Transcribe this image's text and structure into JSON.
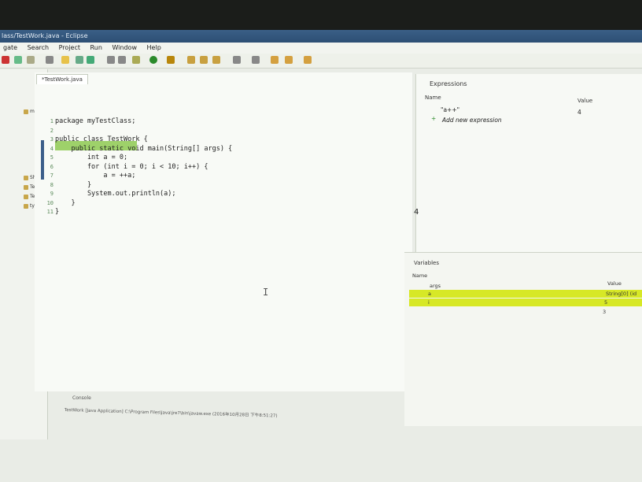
{
  "window": {
    "title": "lass/TestWork.java - Eclipse"
  },
  "menu": [
    "gate",
    "Search",
    "Project",
    "Run",
    "Window",
    "Help"
  ],
  "project_tree": {
    "items": [
      "myT",
      "Sho",
      "Tes",
      "Tes",
      "typ"
    ]
  },
  "editor": {
    "tab_label": "*TestWork.java",
    "lines": [
      {
        "no": "1",
        "text": "package myTestClass;"
      },
      {
        "no": "2",
        "text": ""
      },
      {
        "no": "3",
        "text": "public class TestWork {"
      },
      {
        "no": "4",
        "text": "    public static void main(String[] args) {"
      },
      {
        "no": "5",
        "text": "        int a = 0;"
      },
      {
        "no": "6",
        "text": "        for (int i = 0; i < 10; i++) {"
      },
      {
        "no": "7",
        "text": "            a = ++a;"
      },
      {
        "no": "8",
        "text": "        }"
      },
      {
        "no": "9",
        "text": "        System.out.println(a);"
      },
      {
        "no": "10",
        "text": "    }"
      },
      {
        "no": "11",
        "text": "}"
      }
    ]
  },
  "expressions": {
    "title": "Expressions",
    "col_name": "Name",
    "col_value": "Value",
    "row_name": "\"a++\"",
    "row_value": "4",
    "add_label": "Add new expression",
    "detail_value": "4"
  },
  "variables": {
    "title": "Variables",
    "col_name": "Name",
    "col_value": "Value",
    "rows": [
      {
        "name": "args",
        "value": "String[0] (id"
      },
      {
        "name": "a",
        "value": "5"
      },
      {
        "name": "i",
        "value": "3"
      }
    ]
  },
  "console": {
    "title": "Console",
    "status": "TestWork [Java Application] C:\\Program Files\\Java\\jre7\\bin\\javaw.exe (2016年10月28日 下午8:51:27)"
  },
  "colors": {
    "highlight_line": "#9ed16a",
    "variable_highlight": "#d7e826",
    "titlebar": "#3a5f86"
  }
}
